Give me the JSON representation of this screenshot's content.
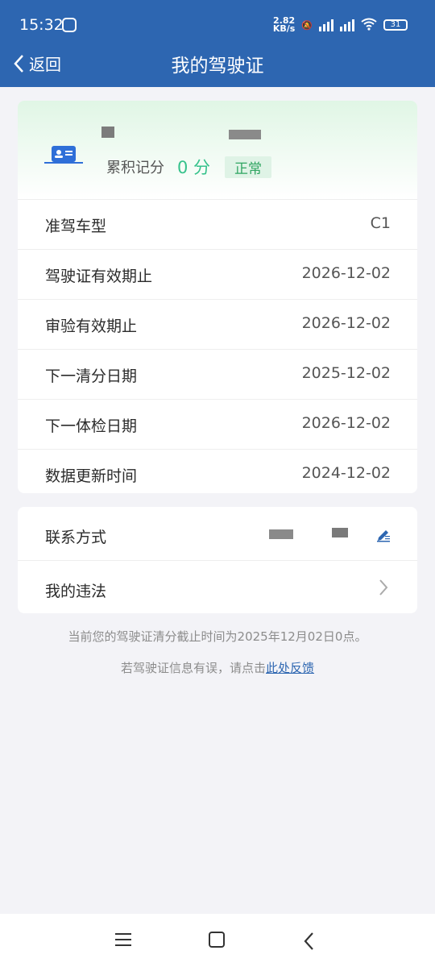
{
  "status_bar": {
    "time": "15:32",
    "speed_top": "2.82",
    "speed_bottom": "KB/s",
    "battery": "31"
  },
  "nav": {
    "back_label": "返回",
    "title": "我的驾驶证"
  },
  "license": {
    "score_label": "累积记分",
    "score_value": "0 分",
    "status": "正常"
  },
  "details": [
    {
      "label": "准驾车型",
      "value": "C1"
    },
    {
      "label": "驾驶证有效期止",
      "value": "2026-12-02"
    },
    {
      "label": "审验有效期止",
      "value": "2026-12-02"
    },
    {
      "label": "下一清分日期",
      "value": "2025-12-02"
    },
    {
      "label": "下一体检日期",
      "value": "2026-12-02"
    },
    {
      "label": "数据更新时间",
      "value": "2024-12-02"
    }
  ],
  "contact": {
    "label": "联系方式"
  },
  "violations": {
    "label": "我的违法"
  },
  "notice": "当前您的驾驶证清分截止时间为2025年12月02日0点。",
  "feedback": {
    "prefix": "若驾驶证信息有误，请点击",
    "link": "此处反馈"
  },
  "colors": {
    "header": "#2d66b1",
    "accent_green": "#36c28c",
    "link": "#2d66b1"
  }
}
